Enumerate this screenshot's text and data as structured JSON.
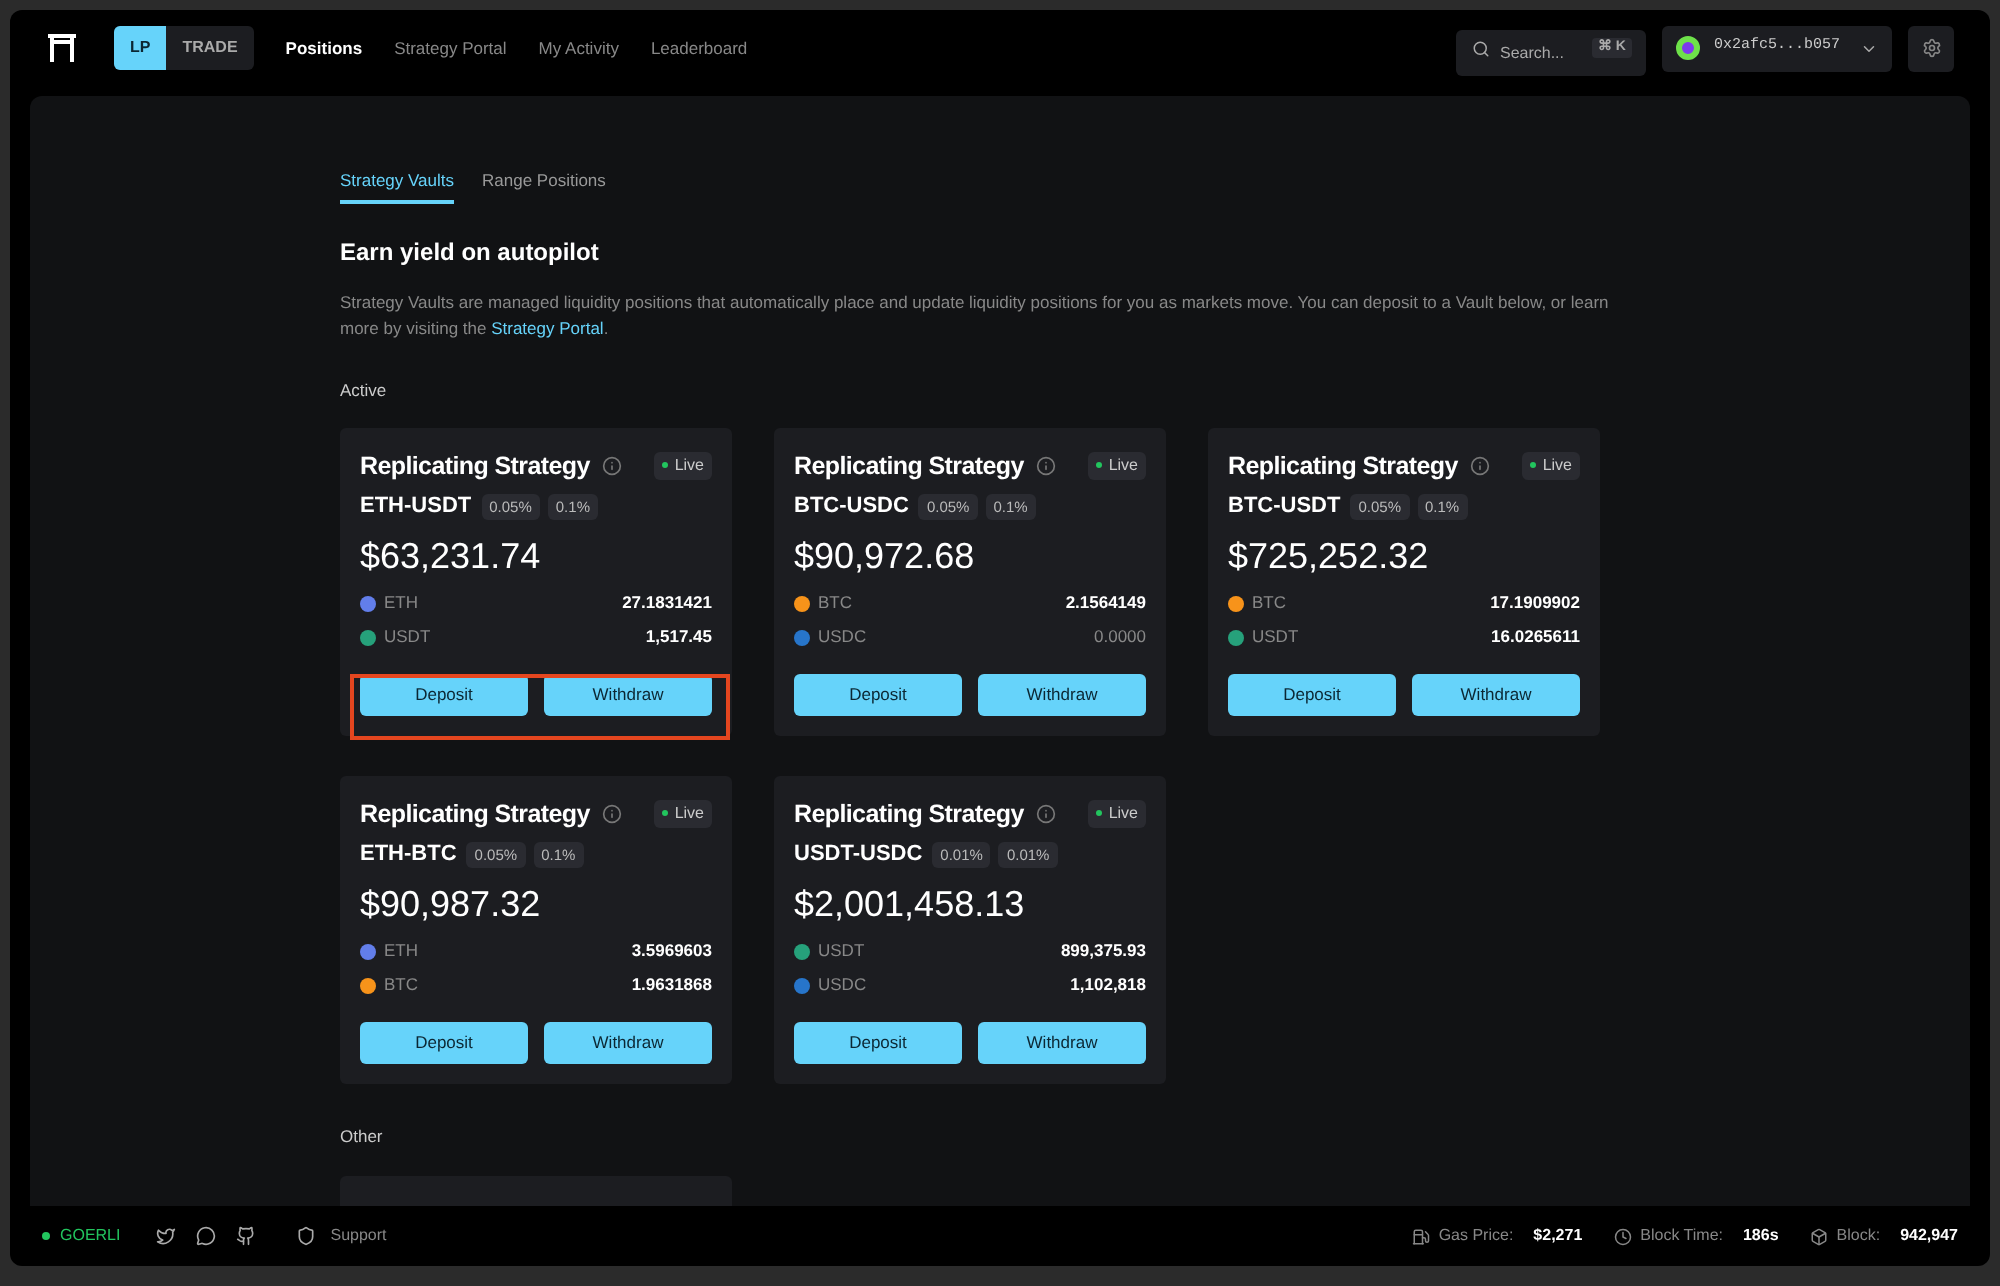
{
  "nav": {
    "modes": [
      {
        "label": "LP",
        "selected": true
      },
      {
        "label": "TRADE",
        "selected": false
      }
    ],
    "links": [
      {
        "label": "Positions",
        "selected": true
      },
      {
        "label": "Strategy Portal",
        "selected": false
      },
      {
        "label": "My Activity",
        "selected": false
      },
      {
        "label": "Leaderboard",
        "selected": false
      }
    ],
    "search": {
      "placeholder": "Search...",
      "shortcut": "⌘ K"
    },
    "wallet": {
      "address": "0x2afc5...b057"
    }
  },
  "tabs": [
    {
      "label": "Strategy Vaults",
      "selected": true
    },
    {
      "label": "Range Positions",
      "selected": false
    }
  ],
  "heading": "Earn yield on autopilot",
  "intro": {
    "text": "Strategy Vaults are managed liquidity positions that automatically place and update liquidity positions for you as markets move. You can deposit to a Vault below, or learn more by visiting the ",
    "link": "Strategy Portal",
    "end": "."
  },
  "active_label": "Active",
  "vaults": [
    {
      "title": "Replicating Strategy",
      "status": "Live",
      "pair": "ETH-USDT",
      "fees": [
        "0.05%",
        "0.1%"
      ],
      "value": "$63,231.74",
      "highlighted": true,
      "tokens": [
        {
          "symbol": "ETH",
          "amount": "27.1831421",
          "color": "#627eea",
          "muted": false
        },
        {
          "symbol": "USDT",
          "amount": "1,517.45",
          "color": "#26a17b",
          "muted": false
        }
      ],
      "buttons": [
        "Deposit",
        "Withdraw"
      ]
    },
    {
      "title": "Replicating Strategy",
      "status": "Live",
      "pair": "BTC-USDC",
      "fees": [
        "0.05%",
        "0.1%"
      ],
      "value": "$90,972.68",
      "highlighted": false,
      "tokens": [
        {
          "symbol": "BTC",
          "amount": "2.1564149",
          "color": "#f7931a",
          "muted": false
        },
        {
          "symbol": "USDC",
          "amount": "0.0000",
          "color": "#2775ca",
          "muted": true
        }
      ],
      "buttons": [
        "Deposit",
        "Withdraw"
      ]
    },
    {
      "title": "Replicating Strategy",
      "status": "Live",
      "pair": "BTC-USDT",
      "fees": [
        "0.05%",
        "0.1%"
      ],
      "value": "$725,252.32",
      "highlighted": false,
      "tokens": [
        {
          "symbol": "BTC",
          "amount": "17.1909902",
          "color": "#f7931a",
          "muted": false
        },
        {
          "symbol": "USDT",
          "amount": "16.0265611",
          "color": "#26a17b",
          "muted": false
        }
      ],
      "buttons": [
        "Deposit",
        "Withdraw"
      ]
    },
    {
      "title": "Replicating Strategy",
      "status": "Live",
      "pair": "ETH-BTC",
      "fees": [
        "0.05%",
        "0.1%"
      ],
      "value": "$90,987.32",
      "highlighted": false,
      "tokens": [
        {
          "symbol": "ETH",
          "amount": "3.5969603",
          "color": "#627eea",
          "muted": false
        },
        {
          "symbol": "BTC",
          "amount": "1.9631868",
          "color": "#f7931a",
          "muted": false
        }
      ],
      "buttons": [
        "Deposit",
        "Withdraw"
      ]
    },
    {
      "title": "Replicating Strategy",
      "status": "Live",
      "pair": "USDT-USDC",
      "fees": [
        "0.01%",
        "0.01%"
      ],
      "value": "$2,001,458.13",
      "highlighted": false,
      "tokens": [
        {
          "symbol": "USDT",
          "amount": "899,375.93",
          "color": "#26a17b",
          "muted": false
        },
        {
          "symbol": "USDC",
          "amount": "1,102,818",
          "color": "#2775ca",
          "muted": false
        }
      ],
      "buttons": [
        "Deposit",
        "Withdraw"
      ]
    }
  ],
  "other_label": "Other",
  "footer": {
    "network": "GOERLI",
    "support": "Support",
    "stats": [
      {
        "kind": "gas",
        "label": "Gas Price:",
        "value": "$2,271"
      },
      {
        "kind": "time",
        "label": "Block Time:",
        "value": "186s"
      },
      {
        "kind": "block",
        "label": "Block:",
        "value": "942,947"
      }
    ]
  }
}
